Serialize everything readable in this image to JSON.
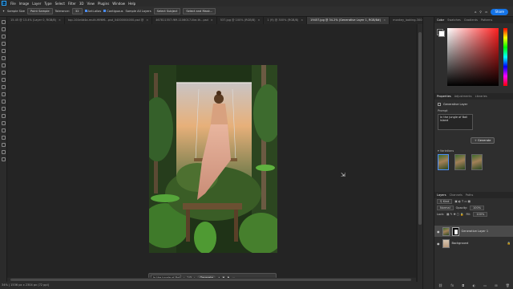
{
  "menubar": {
    "app_icon": "Ps",
    "items": [
      "File",
      "Image",
      "Layer",
      "Type",
      "Select",
      "Filter",
      "3D",
      "View",
      "Plugins",
      "Window",
      "Help"
    ]
  },
  "options": {
    "sample_size": "Sample Size",
    "point_sample": "Point Sample",
    "tolerance_label": "Tolerance:",
    "tolerance_value": "32",
    "anti_alias": "Anti-alias",
    "contiguous": "Contiguous",
    "sample_all_layers": "Sample All Layers",
    "select_subject": "Select Subject",
    "select_and_mask": "Select and Mask...",
    "share": "Share"
  },
  "tabs": [
    {
      "label": "15.45 @ 13.4% (Layer 0, RGB/8)"
    },
    {
      "label": "top-104e4d4a-multi-f6f6f6...psd_04000004000.psd @"
    },
    {
      "label": "467811557-f69-1106017-like-th...psd"
    },
    {
      "label": "537.jpg @ 100% (RGB/8)"
    },
    {
      "label": "1 (9) @ 300% (RGB/8)"
    },
    {
      "label": "19457.jpg @ 34.2% (Generative Layer 1, RGB/8#)",
      "active": true
    },
    {
      "label": "monkey_looking-300x161.jpg @ 100% (RGB/8)"
    }
  ],
  "status": "34% | 1536 px x 2304 px (72 ppi)",
  "taskbar": {
    "prompt": "In the jungle of Bali...",
    "counter": "2/3",
    "generate": "Generate"
  },
  "color_panel": {
    "tabs": [
      "Color",
      "Swatches",
      "Gradients",
      "Patterns"
    ]
  },
  "properties": {
    "tabs": [
      "Properties",
      "Adjustments",
      "Libraries"
    ],
    "layer_type": "Generative Layer",
    "prompt_label": "Prompt",
    "prompt_text": "In the jungle of Bali island",
    "generate": "Generate",
    "variations_label": "Variations"
  },
  "layers": {
    "tabs": [
      "Layers",
      "Channels",
      "Paths"
    ],
    "kind": "Kind",
    "blend": "Normal",
    "opacity_label": "Opacity:",
    "opacity": "100%",
    "lock_label": "Lock:",
    "fill_label": "Fill:",
    "fill": "100%",
    "items": [
      {
        "name": "Generative Layer 1",
        "selected": true
      },
      {
        "name": "Background"
      }
    ]
  }
}
